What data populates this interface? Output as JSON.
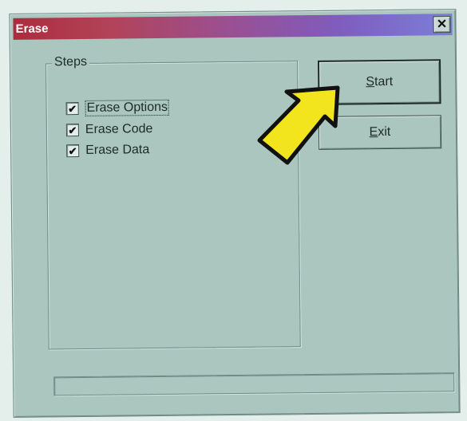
{
  "window": {
    "title": "Erase",
    "close_glyph": "✕"
  },
  "steps": {
    "group_label": "Steps",
    "items": [
      {
        "label": "Erase Options",
        "checked": true,
        "focused": true
      },
      {
        "label": "Erase Code",
        "checked": true,
        "focused": false
      },
      {
        "label": "Erase Data",
        "checked": true,
        "focused": false
      }
    ],
    "check_glyph": "✔"
  },
  "buttons": {
    "start_label": "Start",
    "exit_label": "Exit"
  },
  "progress": {
    "value": 0
  },
  "icons": {
    "callout": "arrow-pointer-icon",
    "close": "close-icon",
    "check": "checkmark-icon"
  },
  "colors": {
    "window_bg": "#aac6bf",
    "title_gradient_start": "#ab2d3d",
    "title_gradient_end": "#7b7fd8",
    "callout_fill": "#f3e51d"
  }
}
